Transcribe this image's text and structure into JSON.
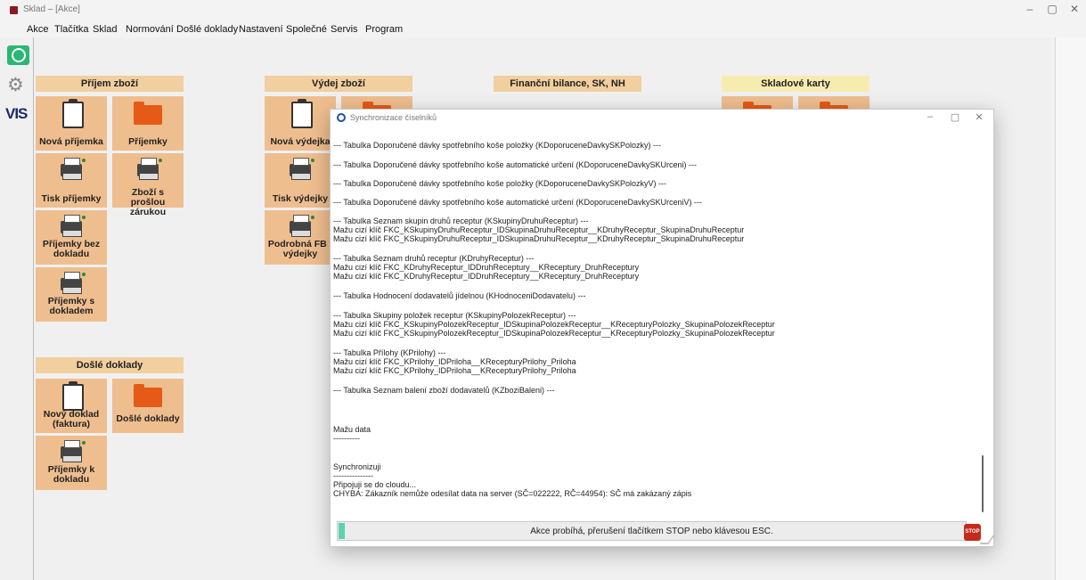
{
  "window": {
    "title": "Sklad – [Akce]",
    "min": "–",
    "max": "▢",
    "close": "✕",
    "mdi_min": "-",
    "mdi_restore": "❐",
    "mdi_close": "✕"
  },
  "menu": [
    "Akce",
    "Tlačítka",
    "Sklad",
    "Normování",
    "Došlé doklady",
    "Nastavení",
    "Společné",
    "Servis",
    "Program"
  ],
  "left_toolbar": {
    "logo": "VIS",
    "gear_icon": "⚙"
  },
  "sections": {
    "prijem_header": "Příjem zboží",
    "vydej_header": "Výdej zboží",
    "bilance_header": "Finanční bilance, SK, NH",
    "karty_header": "Skladové karty",
    "dosle_header": "Došlé doklady"
  },
  "tiles": {
    "nova_prijemka": "Nová příjemka",
    "prijemky": "Příjemky",
    "tisk_prijemky": "Tisk příjemky",
    "zbozi_proslou": "Zboží s prošlou zárukou",
    "prijemky_bez": "Příjemky bez dokladu",
    "prijemky_s": "Příjemky s dokladem",
    "nova_vydejka": "Nová výdejka",
    "tisk_vydejky": "Tisk výdejky",
    "podrobna_fb": "Podrobná FB - výdejky",
    "novy_doklad": "Nový doklad (faktura)",
    "dosle_doklady": "Došlé doklady",
    "prijemky_k": "Příjemky k dokladu"
  },
  "dialog": {
    "title": "Synchronizace číselníků",
    "min": "–",
    "max": "▢",
    "close": "✕",
    "log": [
      "--- Tabulka Doporučené dávky spotřebního koše položky (KDoporuceneDavkySKPolozky) ---",
      "--- Tabulka Doporučené dávky spotřebního koše automatické určení (KDoporuceneDavkySKUrceni) ---",
      "--- Tabulka Doporučené dávky spotřebního koše položky (KDoporuceneDavkySKPolozkyV) ---",
      "--- Tabulka Doporučené dávky spotřebního koše automatické určení (KDoporuceneDavkySKUrceniV) ---",
      "--- Tabulka Seznam skupin druhů receptur (KSkupinyDruhuReceptur) ---",
      "Mažu cizí klíč FKC_KSkupinyDruhuReceptur_IDSkupinaDruhuReceptur__KDruhyReceptur_SkupinaDruhuReceptur",
      "Mažu cizí klíč FKC_KSkupinyDruhuReceptur_IDSkupinaDruhuReceptur__KDruhyReceptur_SkupinaDruhuReceptur",
      "--- Tabulka Seznam druhů receptur (KDruhyReceptur) ---",
      "Mažu cizí klíč FKC_KDruhyReceptur_IDDruhReceptury__KReceptury_DruhReceptury",
      "Mažu cizí klíč FKC_KDruhyReceptur_IDDruhReceptury__KReceptury_DruhReceptury",
      "--- Tabulka Hodnocení dodavatelů jídelnou (KHodnoceniDodavatelu) ---",
      "--- Tabulka Skupiny položek receptur (KSkupinyPolozekReceptur) ---",
      "Mažu cizí klíč FKC_KSkupinyPolozekReceptur_IDSkupinaPolozekReceptur__KRecepturyPolozky_SkupinaPolozekReceptur",
      "Mažu cizí klíč FKC_KSkupinyPolozekReceptur_IDSkupinaPolozekReceptur__KRecepturyPolozky_SkupinaPolozekReceptur",
      "--- Tabulka Přílohy (KPrilohy) ---",
      "Mažu cizí klíč FKC_KPrilohy_IDPriloha__KRecepturyPrilohy_Priloha",
      "Mažu cizí klíč FKC_KPrilohy_IDPriloha__KRecepturyPrilohy_Priloha",
      "--- Tabulka Seznam balení zboží dodavatelů (KZboziBaleni) ---",
      "Mažu data",
      "----------",
      "Synchronizuji",
      "---------------",
      "Připojuji se do cloudu...",
      "CHYBA: Zákazník nemůže odesílat data na server (SČ=022222, RČ=44954): SČ má zakázaný zápis"
    ],
    "status": "Akce probíhá, přerušení tlačítkem STOP nebo klávesou ESC.",
    "progress_percent": 1,
    "stop_label": "STOP"
  },
  "colors": {
    "tile": "#efbe8f",
    "section_header": "#f1cf9f",
    "section_header_yellow": "#f7ecb0",
    "progress": "#5fd1b3",
    "stop": "#c42b1c"
  }
}
